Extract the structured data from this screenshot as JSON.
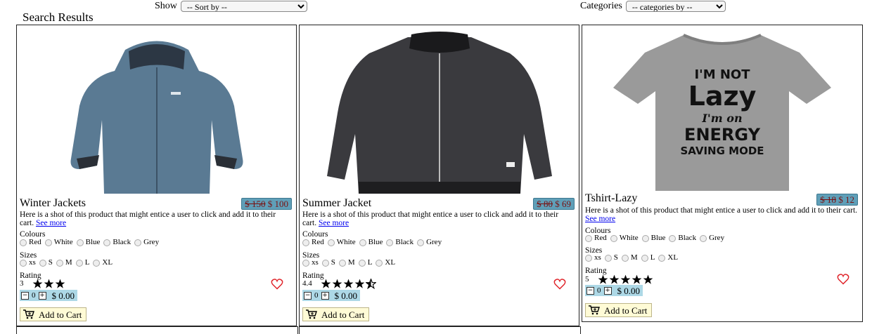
{
  "toolbar": {
    "show_label": "Show",
    "sort_value": "-- Sort by --",
    "categories_label": "Categories",
    "categories_value": "-- categories by --"
  },
  "page_title": "Search Results",
  "products": [
    {
      "name": "Winter Jackets",
      "old_price": "$ 150",
      "new_price": "$ 100",
      "desc": "Here is a shot of this product that might entice a user to click and add it to their cart.",
      "see_more": "See more",
      "colours_label": "Colours",
      "colours": [
        "Red",
        "White",
        "Blue",
        "Black",
        "Grey"
      ],
      "sizes_label": "Sizes",
      "sizes": [
        "xs",
        "S",
        "M",
        "L",
        "XL"
      ],
      "rating_label": "Rating",
      "rating": "3",
      "stars": 3,
      "qty": "0",
      "total": "$ 0.00",
      "cart_label": "Add to Cart",
      "image": "winter-jacket-image"
    },
    {
      "name": "Summer Jacket",
      "old_price": "$ 80",
      "new_price": "$ 69",
      "desc": "Here is a shot of this product that might entice a user to click and add it to their cart.",
      "see_more": "See more",
      "colours_label": "Colours",
      "colours": [
        "Red",
        "White",
        "Blue",
        "Black",
        "Grey"
      ],
      "sizes_label": "Sizes",
      "sizes": [
        "xs",
        "S",
        "M",
        "L",
        "XL"
      ],
      "rating_label": "Rating",
      "rating": "4.4",
      "stars": 4.5,
      "qty": "0",
      "total": "$ 0.00",
      "cart_label": "Add to Cart",
      "image": "summer-jacket-image"
    },
    {
      "name": "Tshirt-Lazy",
      "old_price": "$ 18",
      "new_price": "$ 12",
      "desc": "Here is a shot of this product that might entice a user to click and add it to their cart.",
      "see_more": "See more",
      "colours_label": "Colours",
      "colours": [
        "Red",
        "White",
        "Blue",
        "Black",
        "Grey"
      ],
      "sizes_label": "Sizes",
      "sizes": [
        "xs",
        "S",
        "M",
        "L",
        "XL"
      ],
      "rating_label": "Rating",
      "rating": "5",
      "stars": 5,
      "qty": "0",
      "total": "$ 0.00",
      "cart_label": "Add to Cart",
      "image": "tshirt-lazy-image",
      "shirt_print": [
        "I'M NOT",
        "Lazy",
        "I'm on",
        "ENERGY",
        "SAVING MODE"
      ]
    }
  ],
  "colors": {
    "price_bg": "#5f9fb8",
    "qty_bg": "#add8e6",
    "cart_bg": "#fffbd6",
    "heart": "#e0242a"
  }
}
